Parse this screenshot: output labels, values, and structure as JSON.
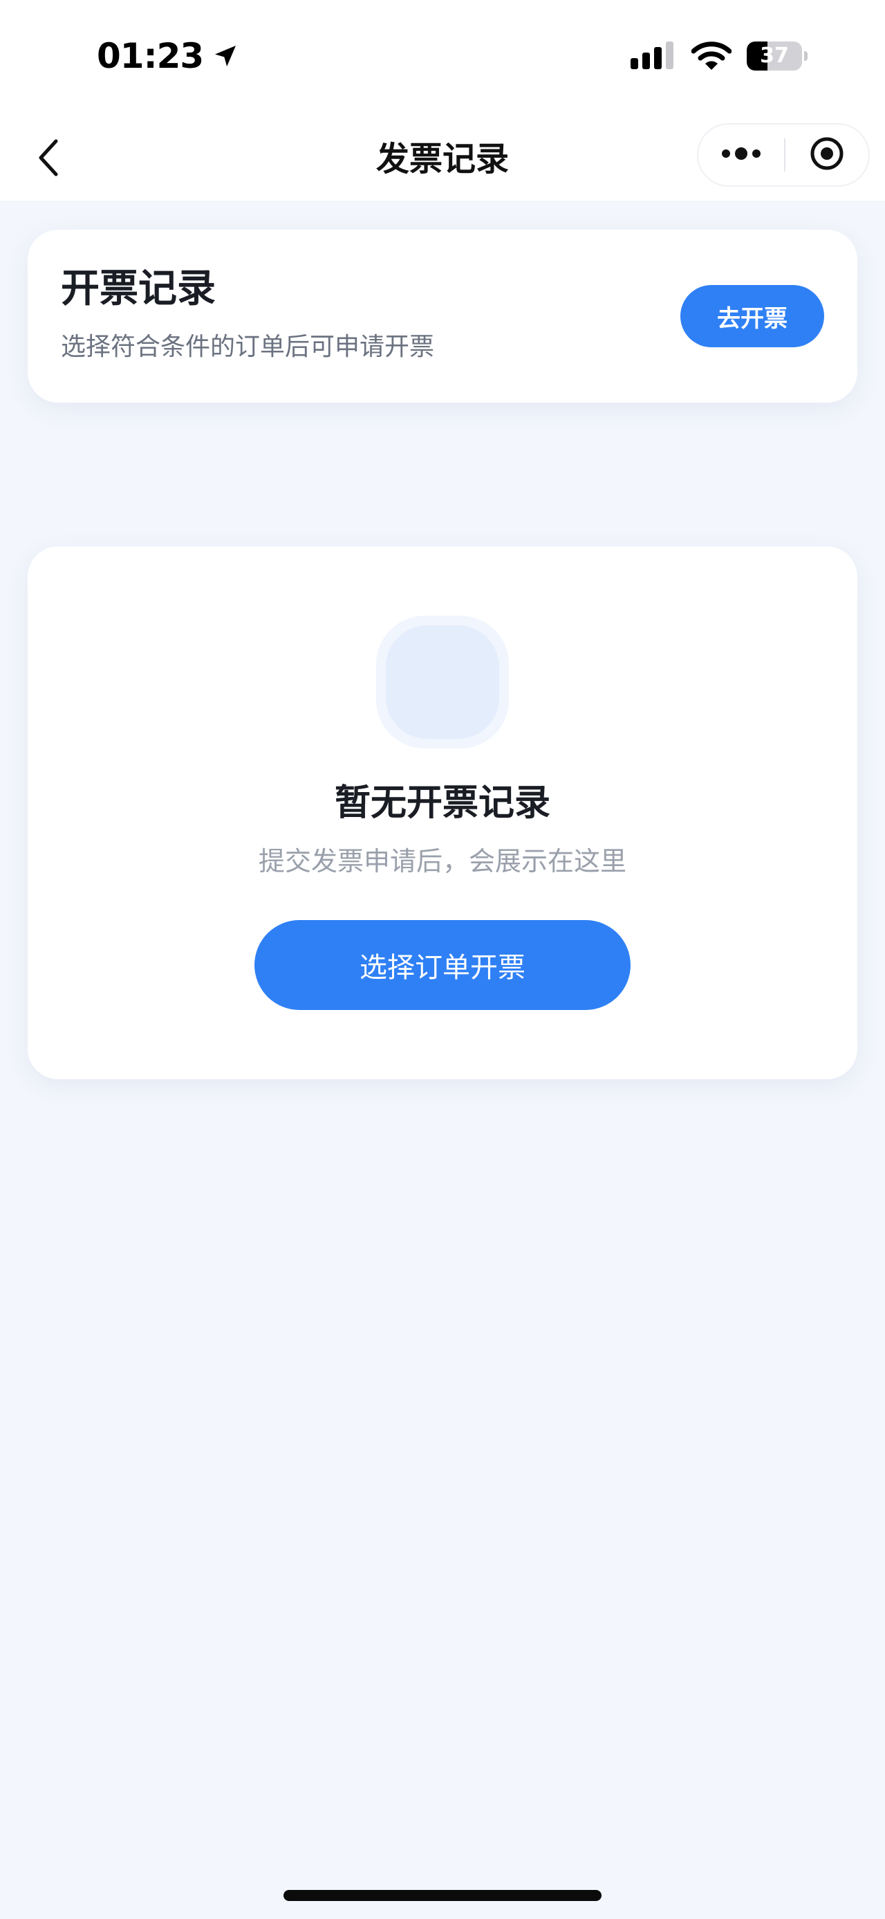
{
  "status_bar": {
    "time": "01:23",
    "battery_level": "37",
    "battery_fraction": 0.37,
    "icons": [
      "location-arrow-icon",
      "signal-icon",
      "wifi-icon",
      "battery-icon"
    ]
  },
  "nav": {
    "title": "发票记录",
    "icons": [
      "chevron-left-icon",
      "more-dots-icon",
      "close-target-icon"
    ]
  },
  "header_card": {
    "title": "开票记录",
    "subtitle": "选择符合条件的订单后可申请开票",
    "action_label": "去开票"
  },
  "empty_state": {
    "title": "暂无开票记录",
    "description": "提交发票申请后，会展示在这里",
    "button_label": "选择订单开票"
  },
  "colors": {
    "primary": "#2f80f5",
    "page_background": "#f3f6fc",
    "card_background": "#ffffff",
    "text_primary": "#1a1d24",
    "text_secondary": "#6b7280",
    "text_muted": "#9aa0ab"
  }
}
